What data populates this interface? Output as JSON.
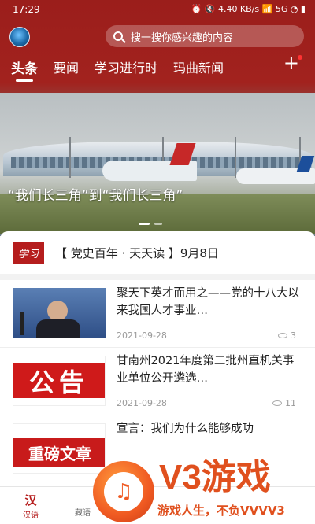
{
  "statusbar": {
    "time": "17:29",
    "icons_text": "⏰ 🔇 4.40 KB/s 📶 5G ◔ ▮"
  },
  "search": {
    "placeholder": "搜一搜你感兴趣的内容"
  },
  "tabs": [
    "头条",
    "要闻",
    "学习进行时",
    "玛曲新闻"
  ],
  "banner": {
    "caption": "“我们长三角”到“我们长三角”"
  },
  "daily": {
    "badge": "学习",
    "text": "【 党史百年 · 天天读 】9月8日"
  },
  "news": [
    {
      "title": "聚天下英才而用之——党的十八大以来我国人才事业…",
      "date": "2021-09-28",
      "views": "3"
    },
    {
      "title": "甘南州2021年度第二批州直机关事业单位公开遴选…",
      "date": "2021-09-28",
      "views": "11",
      "thumb_text": "公告"
    },
    {
      "title": "宣言：我们为什么能够成功",
      "thumb_text": "重磅文章"
    }
  ],
  "bottomnav": [
    {
      "glyph": "汉",
      "label": "汉语"
    },
    {
      "glyph": "",
      "label": "藏语"
    }
  ],
  "watermark": {
    "brand": "V3游戏",
    "slogan": "游戏人生，不负VVVV3"
  },
  "colors": {
    "brand_red": "#a2221e",
    "watermark_orange": "#e0501e"
  }
}
